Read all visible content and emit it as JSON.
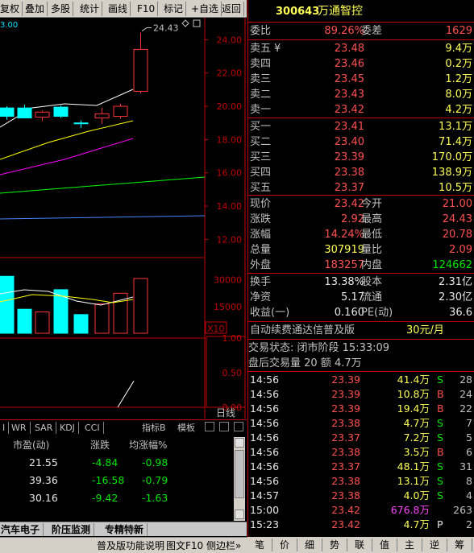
{
  "toolbar": {
    "items": [
      "复权",
      "叠加",
      "多股",
      "统计",
      "画线",
      "F10",
      "标记",
      "+自选",
      "返回"
    ]
  },
  "chart": {
    "top_left_value": "3.00",
    "high_label": "24.43",
    "price_axis": [
      "24.00",
      "22.00",
      "20.00",
      "18.00",
      "16.00",
      "14.00",
      "12.00"
    ],
    "volume_axis": [
      "30000",
      "15000"
    ],
    "volume_multiplier": "X10",
    "indicator_axis": [
      "1.00",
      "0.50",
      "0.00"
    ],
    "period_label": "日线",
    "colors": {
      "up": "#ff3333",
      "down": "#00ffff",
      "ma5": "#ffffff",
      "ma10": "#ffff00",
      "ma20": "#ff00ff",
      "ma30": "#00ff00",
      "ma60": "#4488ff"
    },
    "ohlc": [
      {
        "o": 19.9,
        "h": 20.0,
        "l": 19.2,
        "c": 19.4
      },
      {
        "o": 19.9,
        "h": 20.1,
        "l": 19.4,
        "c": 19.3
      },
      {
        "o": 19.35,
        "h": 19.75,
        "l": 19.1,
        "c": 19.65
      },
      {
        "o": 19.95,
        "h": 20.05,
        "l": 19.3,
        "c": 19.4
      },
      {
        "o": 19.0,
        "h": 19.15,
        "l": 18.7,
        "c": 18.95
      },
      {
        "o": 19.3,
        "h": 19.9,
        "l": 18.95,
        "c": 19.55
      },
      {
        "o": 19.4,
        "h": 20.15,
        "l": 19.25,
        "c": 20.0
      },
      {
        "o": 20.9,
        "h": 24.43,
        "l": 20.78,
        "c": 23.42
      }
    ],
    "volumes": [
      32000,
      13500,
      12000,
      24500,
      10500,
      16500,
      22500,
      30800
    ],
    "indicator_end": [
      0.0,
      0.38
    ]
  },
  "quote": {
    "code": "300643",
    "name": "万通智控",
    "weibi_label": "委比",
    "weibi": "89.26%",
    "weicha_label": "委差",
    "weicha": "1629",
    "asks": [
      {
        "label": "卖五",
        "mark": "¥",
        "price": "23.48",
        "vol": "9.4万"
      },
      {
        "label": "卖四",
        "mark": "",
        "price": "23.46",
        "vol": "0.2万"
      },
      {
        "label": "卖三",
        "mark": "",
        "price": "23.45",
        "vol": "1.2万"
      },
      {
        "label": "卖二",
        "mark": "",
        "price": "23.43",
        "vol": "8.0万"
      },
      {
        "label": "卖一",
        "mark": "",
        "price": "23.42",
        "vol": "4.2万"
      }
    ],
    "bids": [
      {
        "label": "买一",
        "price": "23.41",
        "vol": "13.1万"
      },
      {
        "label": "买二",
        "price": "23.40",
        "vol": "71.4万"
      },
      {
        "label": "买三",
        "price": "23.39",
        "vol": "170.0万"
      },
      {
        "label": "买四",
        "price": "23.38",
        "vol": "138.9万"
      },
      {
        "label": "买五",
        "price": "23.37",
        "vol": "10.5万"
      }
    ],
    "stats1": [
      {
        "l1": "现价",
        "v1": "23.42",
        "l2": "今开",
        "v2": "21.00"
      },
      {
        "l1": "涨跌",
        "v1": "2.92",
        "l2": "最高",
        "v2": "24.43"
      },
      {
        "l1": "涨幅",
        "v1": "14.24%",
        "l2": "最低",
        "v2": "20.78"
      },
      {
        "l1": "总量",
        "v1": "307919",
        "l2": "量比",
        "v2": "2.09"
      },
      {
        "l1": "外盘",
        "v1": "183257",
        "l2": "内盘",
        "v2": "124662"
      }
    ],
    "stats2": [
      {
        "l1": "换手",
        "v1": "13.38%",
        "l2": "股本",
        "v2": "2.31亿"
      },
      {
        "l1": "净资",
        "v1": "5.17",
        "l2": "流通",
        "v2": "2.30亿"
      },
      {
        "l1": "收益(一)",
        "v1": "0.160",
        "l2": "PE(动)",
        "v2": "36.6"
      }
    ],
    "promo": "自动续费通达信普及版",
    "promo_price": "30元/月",
    "trade_status": "交易状态: 闭市阶段 15:33:09",
    "after_hours": "盘后交易量 20 额 4.7万"
  },
  "ticks": [
    {
      "t": "14:56",
      "p": "23.39",
      "v": "41.4万",
      "f": "S",
      "n": "28"
    },
    {
      "t": "14:56",
      "p": "23.39",
      "v": "10.8万",
      "f": "B",
      "n": "24"
    },
    {
      "t": "14:56",
      "p": "23.39",
      "v": "19.4万",
      "f": "B",
      "n": "22"
    },
    {
      "t": "14:56",
      "p": "23.38",
      "v": "4.7万",
      "f": "S",
      "n": "7"
    },
    {
      "t": "14:56",
      "p": "23.37",
      "v": "7.2万",
      "f": "S",
      "n": "5"
    },
    {
      "t": "14:56",
      "p": "23.38",
      "v": "3.5万",
      "f": "B",
      "n": "6"
    },
    {
      "t": "14:56",
      "p": "23.37",
      "v": "48.1万",
      "f": "S",
      "n": "31"
    },
    {
      "t": "14:56",
      "p": "23.38",
      "v": "13.1万",
      "f": "S",
      "n": "8"
    },
    {
      "t": "14:57",
      "p": "23.38",
      "v": "4.0万",
      "f": "S",
      "n": "4"
    },
    {
      "t": "15:00",
      "p": "23.42",
      "v": "676.8万",
      "f": "",
      "n": "263"
    },
    {
      "t": "15:23",
      "p": "23.42",
      "v": "4.7万",
      "f": "P",
      "n": "2"
    }
  ],
  "indicator_tabs": [
    "I",
    "WR",
    "SAR",
    "KDJ",
    "CCI"
  ],
  "indicator_label": "指标B",
  "template_label": "模板",
  "table": {
    "headers": [
      "市盈(动)",
      "涨跌",
      "均涨幅%"
    ],
    "rows": [
      [
        "21.55",
        "-4.84",
        "-0.98"
      ],
      [
        "39.36",
        "-16.58",
        "-0.79"
      ],
      [
        "30.16",
        "-9.42",
        "-1.63"
      ]
    ]
  },
  "bottom_tabs": [
    "汽车电子",
    "阶压监测",
    "专精特新"
  ],
  "status_items": [
    "普及版功能说明",
    "图文F10",
    "侧边栏»"
  ],
  "right_tabs": [
    "笔",
    "价",
    "细",
    "势",
    "联",
    "值",
    "主",
    "逆",
    "筹"
  ]
}
